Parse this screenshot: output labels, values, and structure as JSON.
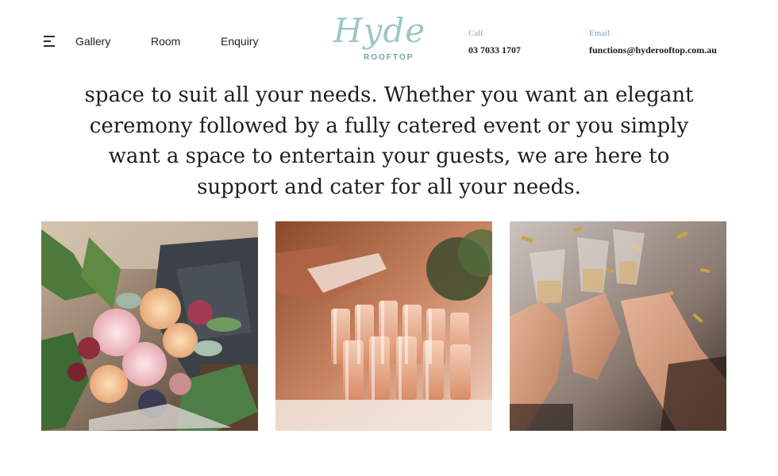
{
  "nav": {
    "menu_icon": "hamburger-icon",
    "links": [
      "Gallery",
      "Room",
      "Enquiry"
    ]
  },
  "logo": {
    "script": "Hyde",
    "sub": "ROOFTOP"
  },
  "contact": {
    "call_label": "Call",
    "call_value": "03 7033 1707",
    "email_label": "Email",
    "email_value": "functions@hyderooftop.com.au"
  },
  "intro": {
    "lines": [
      "space to suit all your needs. Whether you want an elegant",
      "ceremony followed by a fully catered event or you simply",
      "want a space to entertain your guests, we are here to",
      "support and cater for all your needs."
    ]
  },
  "gallery": {
    "images": [
      "flower-arrangement-photo",
      "champagne-tower-photo",
      "toasting-glasses-photo"
    ]
  },
  "colors": {
    "logo_teal": "#9cc7c4",
    "contact_label": "#7aa5b8",
    "text": "#1c1c1c"
  }
}
